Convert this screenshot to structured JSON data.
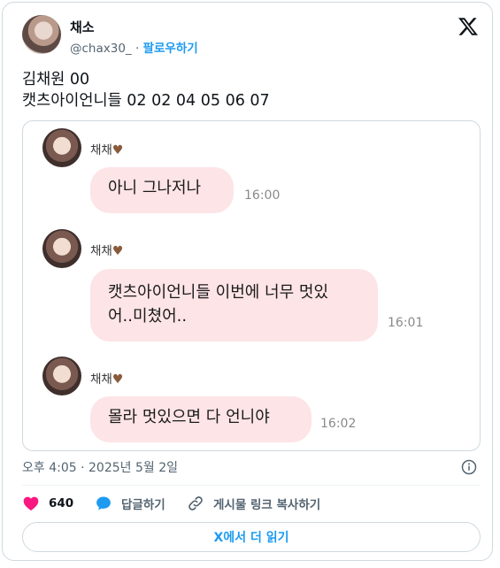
{
  "author": {
    "display_name": "채소",
    "handle": "@chax30_",
    "separator": "·",
    "follow_label": "팔로우하기"
  },
  "tweet": {
    "line1": "김채원 00",
    "line2": "캣츠아이언니들 02 02 04 05 06 07"
  },
  "chat": {
    "messages": [
      {
        "sender": "채채",
        "text": "아니 그나저나",
        "time": "16:00"
      },
      {
        "sender": "채채",
        "text_line1": "캣츠아이언니들 이번에 너무 멋있",
        "text_line2": "어..미쳤어..",
        "time": "16:01"
      },
      {
        "sender": "채채",
        "text": "몰라 멋있으면 다 언니야",
        "time": "16:02"
      }
    ],
    "heart_color": "#8a5a3b",
    "bubble_color": "#fde4e6"
  },
  "meta": {
    "timestamp": "오후 4:05 · 2025년 5월 2일"
  },
  "actions": {
    "like_count": "640",
    "reply_label": "답글하기",
    "copy_link_label": "게시물 링크 복사하기"
  },
  "read_more_label": "X에서 더 읽기",
  "colors": {
    "accent": "#1d9bf0",
    "like": "#f91880",
    "muted": "#536471"
  },
  "icons": [
    "x-logo-icon",
    "heart-icon",
    "reply-bubble-icon",
    "link-icon",
    "info-icon"
  ]
}
